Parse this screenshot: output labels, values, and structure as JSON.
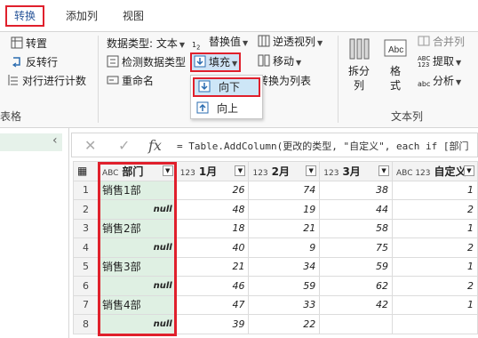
{
  "tabs": [
    {
      "label": "转换",
      "active": true
    },
    {
      "label": "添加列",
      "active": false
    },
    {
      "label": "视图",
      "active": false
    }
  ],
  "ribbon": {
    "col1": {
      "transpose": "转置",
      "reverse_rows": "反转行",
      "count_rows": "对行进行计数"
    },
    "col2": {
      "data_type": "数据类型: 文本",
      "detect_type": "检测数据类型",
      "rename": "重命名"
    },
    "col3": {
      "replace_values": "替换值",
      "fill": "填充",
      "convert_list": "转换为列表"
    },
    "col4": {
      "unpivot": "逆透视列",
      "move": "移动"
    },
    "text_group": {
      "split": "拆分\n列",
      "format": "格\n式",
      "merge": "合并列",
      "extract": "提取",
      "parse": "分析",
      "label": "文本列"
    },
    "left_label": "表格"
  },
  "fill_menu": {
    "down": "向下",
    "up": "向上"
  },
  "formula": {
    "text": "= Table.AddColumn(更改的类型, \"自定义\", each if [部门"
  },
  "grid": {
    "columns": [
      {
        "type": "ABC",
        "name": "部门"
      },
      {
        "type": "123",
        "name": "1月"
      },
      {
        "type": "123",
        "name": "2月"
      },
      {
        "type": "123",
        "name": "3月"
      },
      {
        "type": "ABC 123",
        "name": "自定义"
      }
    ],
    "rows": [
      {
        "i": "1",
        "dept": "销售1部",
        "m1": "26",
        "m2": "74",
        "m3": "38",
        "c": "1"
      },
      {
        "i": "2",
        "dept": "null",
        "m1": "48",
        "m2": "19",
        "m3": "44",
        "c": "2"
      },
      {
        "i": "3",
        "dept": "销售2部",
        "m1": "18",
        "m2": "21",
        "m3": "58",
        "c": "1"
      },
      {
        "i": "4",
        "dept": "null",
        "m1": "40",
        "m2": "9",
        "m3": "75",
        "c": "2"
      },
      {
        "i": "5",
        "dept": "销售3部",
        "m1": "21",
        "m2": "34",
        "m3": "59",
        "c": "1"
      },
      {
        "i": "6",
        "dept": "null",
        "m1": "46",
        "m2": "59",
        "m3": "62",
        "c": "2"
      },
      {
        "i": "7",
        "dept": "销售4部",
        "m1": "47",
        "m2": "33",
        "m3": "42",
        "c": "1"
      },
      {
        "i": "8",
        "dept": "null",
        "m1": "39",
        "m2": "22",
        "m3": "",
        "c": ""
      }
    ]
  },
  "colors": {
    "highlight_red": "#e0202c",
    "dept_fill": "#dff0e3",
    "ribbon_bg": "#f8f8f8"
  }
}
